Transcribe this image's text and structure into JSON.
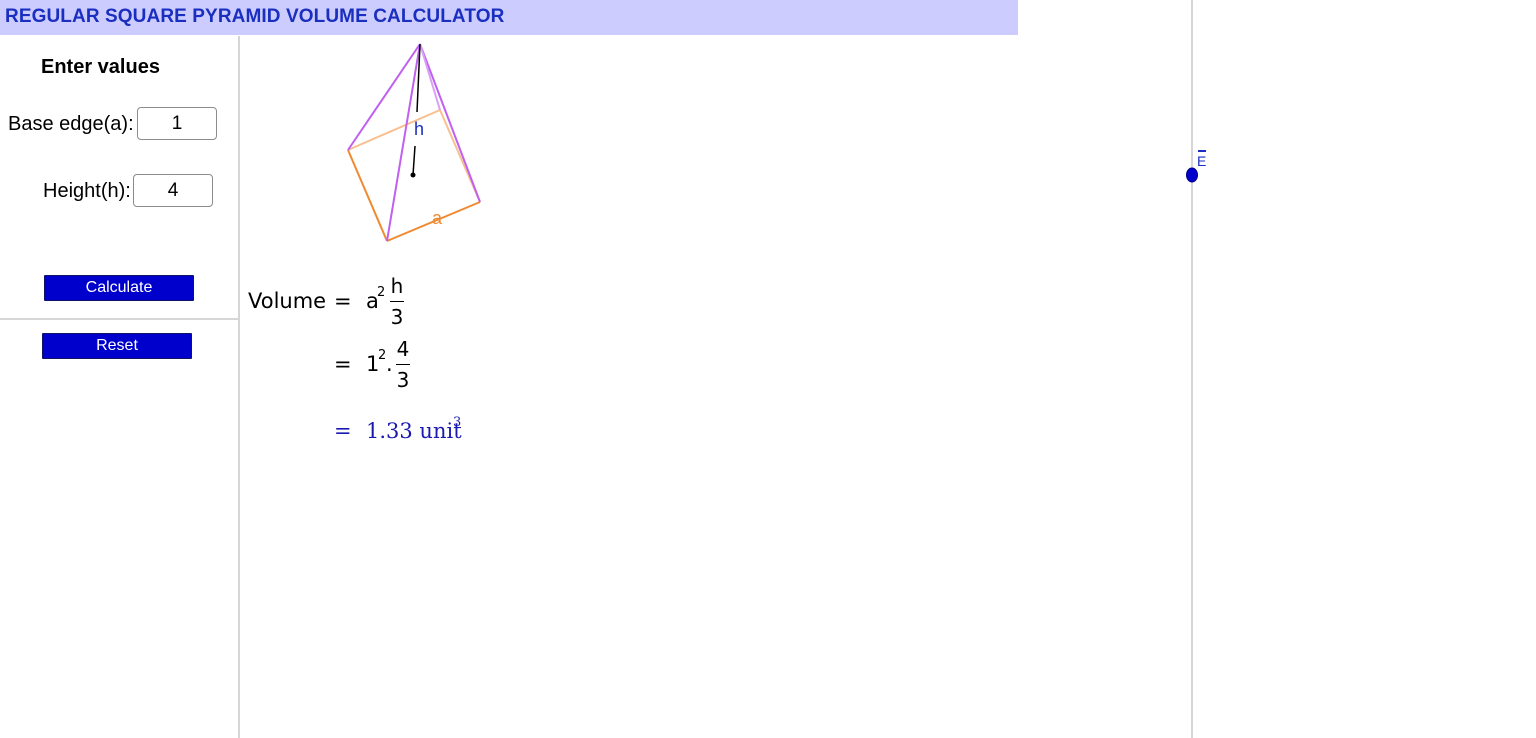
{
  "title": "REGULAR SQUARE PYRAMID VOLUME CALCULATOR",
  "panel": {
    "heading": "Enter values",
    "base_edge_label": "Base edge(a):",
    "base_edge_value": "1",
    "height_label": "Height(h):",
    "height_value": "4",
    "calculate_label": "Calculate",
    "reset_label": "Reset"
  },
  "diagram": {
    "height_label": "h",
    "edge_label": "a"
  },
  "formula": {
    "lhs": "Volume",
    "eq": "=",
    "base_symbol": "a",
    "exponent": "2",
    "num_symbol": "h",
    "den": "3",
    "sub_base": "1",
    "sub_exponent": "2",
    "dot": ".",
    "sub_num": "4",
    "sub_den": "3",
    "result": "1.33 unit",
    "result_exponent": "3"
  },
  "colors": {
    "title_bg": "#ccccff",
    "title_text": "#1a2fbf",
    "button_bg": "#0000cc",
    "edge_purple": "#c060f0",
    "edge_orange": "#f08a30",
    "label_blue": "#1a2fbf"
  }
}
